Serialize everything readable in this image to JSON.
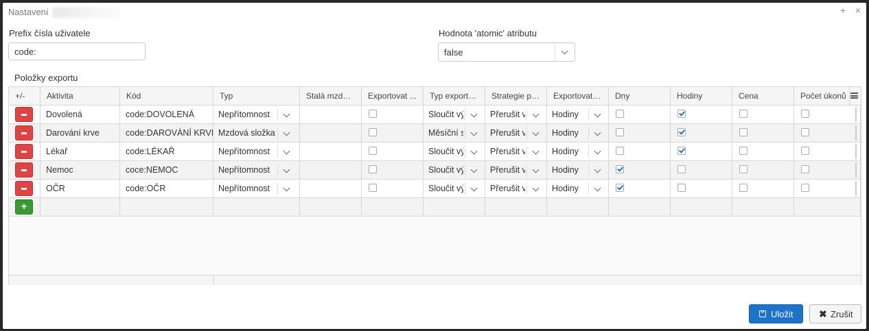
{
  "dialog": {
    "title": "Nastavení",
    "maximize_icon": "+",
    "close_icon": "×"
  },
  "prefix": {
    "label": "Prefix čísla uživatele",
    "value": "code:"
  },
  "atomic": {
    "label": "Hodnota 'atomic' atributu",
    "value": "false"
  },
  "grid": {
    "title": "Položky exportu",
    "columns": [
      "+/-",
      "Aktivita",
      "Kód",
      "Typ",
      "Stalá mzdov...",
      "Exportovat ...",
      "Typ exporto...",
      "Strategie pr...",
      "Exportovat j...",
      "Dny",
      "Hodiny",
      "Cena",
      "Počet úkonů"
    ],
    "rows": [
      {
        "aktivita": "Dovolená",
        "kod": "code:DOVOLENÁ",
        "typ": "Nepřítomnost",
        "typ_exportu": "Sloučit vý",
        "strategie": "Přerušit v",
        "exportovat_j": "Hodiny",
        "dny": false,
        "hodiny": true,
        "cena": false,
        "pocet": false
      },
      {
        "aktivita": "Darování krve",
        "kod": "code:DAROVÁNÍ KRVE",
        "typ": "Mzdová složka",
        "typ_exportu": "Měsíční s",
        "strategie": "Přerušit v",
        "exportovat_j": "Hodiny",
        "dny": false,
        "hodiny": true,
        "cena": false,
        "pocet": false
      },
      {
        "aktivita": "Lékař",
        "kod": "code:LÉKAŘ",
        "typ": "Nepřítomnost",
        "typ_exportu": "Sloučit vý",
        "strategie": "Přerušit v",
        "exportovat_j": "Hodiny",
        "dny": false,
        "hodiny": true,
        "cena": false,
        "pocet": false
      },
      {
        "aktivita": "Nemoc",
        "kod": "coce:NEMOC",
        "typ": "Nepřítomnost",
        "typ_exportu": "Sloučit vý",
        "strategie": "Přerušit v",
        "exportovat_j": "Hodiny",
        "dny": true,
        "hodiny": false,
        "cena": false,
        "pocet": false
      },
      {
        "aktivita": "OČR",
        "kod": "code:OČR",
        "typ": "Nepřítomnost",
        "typ_exportu": "Sloučit vý",
        "strategie": "Přerušit v",
        "exportovat_j": "Hodiny",
        "dny": true,
        "hodiny": false,
        "cena": false,
        "pocet": false
      }
    ]
  },
  "footer": {
    "save_label": "Uložit",
    "cancel_label": "Zrušit",
    "save_icon": "floppy-icon",
    "cancel_icon": "times-icon"
  },
  "colors": {
    "primary": "#1d73c9",
    "remove": "#e04343",
    "add": "#3a9a2f"
  }
}
